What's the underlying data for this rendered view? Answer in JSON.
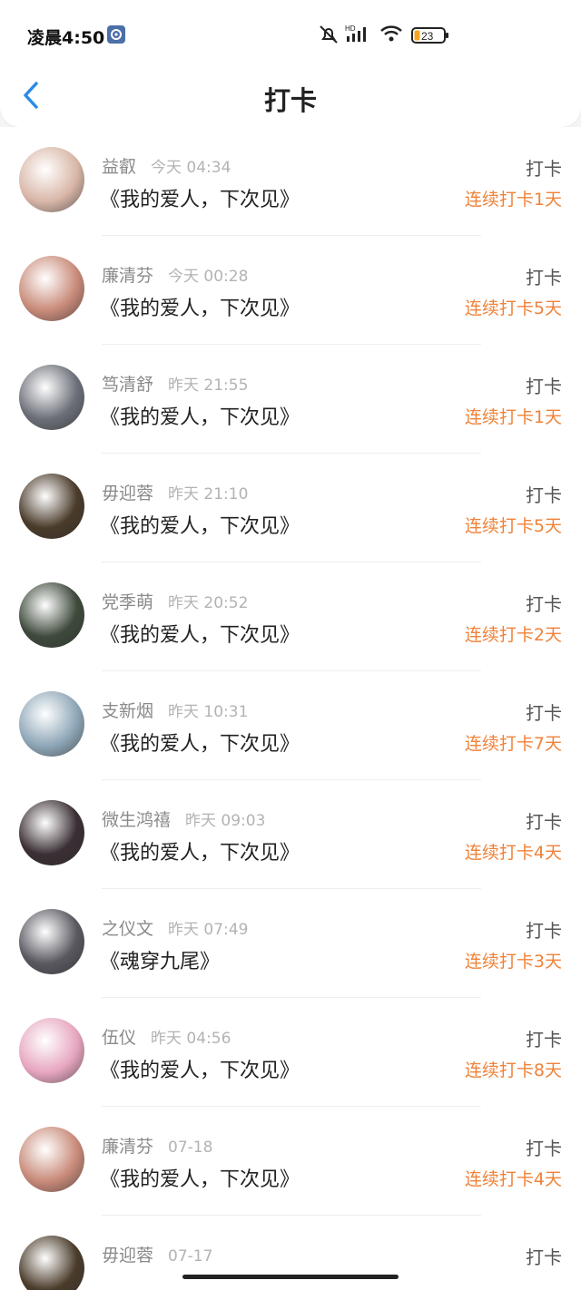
{
  "status": {
    "time": "凌晨4:50",
    "battery": "23",
    "network": "HD"
  },
  "header": {
    "title": "打卡"
  },
  "list": [
    {
      "name": "益叡",
      "time": "今天 04:34",
      "book": "《我的爱人，下次见》",
      "action": "打卡",
      "streak": "连续打卡1天",
      "avatar_color": "#d9b7a8"
    },
    {
      "name": "廉清芬",
      "time": "今天 00:28",
      "book": "《我的爱人，下次见》",
      "action": "打卡",
      "streak": "连续打卡5天",
      "avatar_color": "#c98b7a"
    },
    {
      "name": "笃清舒",
      "time": "昨天 21:55",
      "book": "《我的爱人，下次见》",
      "action": "打卡",
      "streak": "连续打卡1天",
      "avatar_color": "#6c6f78"
    },
    {
      "name": "毋迎蓉",
      "time": "昨天 21:10",
      "book": "《我的爱人，下次见》",
      "action": "打卡",
      "streak": "连续打卡5天",
      "avatar_color": "#4a3b2a"
    },
    {
      "name": "党季萌",
      "time": "昨天 20:52",
      "book": "《我的爱人，下次见》",
      "action": "打卡",
      "streak": "连续打卡2天",
      "avatar_color": "#3e4a3c"
    },
    {
      "name": "支新烟",
      "time": "昨天 10:31",
      "book": "《我的爱人，下次见》",
      "action": "打卡",
      "streak": "连续打卡7天",
      "avatar_color": "#8fa7b8"
    },
    {
      "name": "微生鸿禧",
      "time": "昨天 09:03",
      "book": "《我的爱人，下次见》",
      "action": "打卡",
      "streak": "连续打卡4天",
      "avatar_color": "#3a2f34"
    },
    {
      "name": "之仪文",
      "time": "昨天 07:49",
      "book": "《魂穿九尾》",
      "action": "打卡",
      "streak": "连续打卡3天",
      "avatar_color": "#5a5860"
    },
    {
      "name": "伍仪",
      "time": "昨天 04:56",
      "book": "《我的爱人，下次见》",
      "action": "打卡",
      "streak": "连续打卡8天",
      "avatar_color": "#e7a6c0"
    },
    {
      "name": "廉清芬",
      "time": "07-18",
      "book": "《我的爱人，下次见》",
      "action": "打卡",
      "streak": "连续打卡4天",
      "avatar_color": "#c98b7a"
    },
    {
      "name": "毋迎蓉",
      "time": "07-17",
      "book": "",
      "action": "打卡",
      "streak": "",
      "avatar_color": "#4a3b2a"
    }
  ]
}
